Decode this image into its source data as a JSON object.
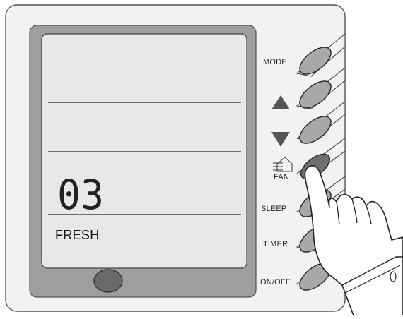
{
  "display": {
    "readout_digits": "03",
    "mode_text": "FRESH"
  },
  "buttons": {
    "mode_label": "MODE",
    "fan_label": "FAN",
    "sleep_label": "SLEEP",
    "timer_label": "TIMER",
    "onoff_label": "ON/OFF"
  },
  "icons": {
    "up": "triangle-up-icon",
    "down": "triangle-down-icon",
    "fan": "fresh-air-house-icon",
    "hand": "pointing-hand-icon"
  },
  "colors": {
    "body": "#f2f2f2",
    "bezel": "#9e9e9e",
    "lcd": "#e8e8e8",
    "button": "#a8a8a8",
    "button_pressed": "#6f6f6f",
    "indicator": "#6a6a6a"
  }
}
